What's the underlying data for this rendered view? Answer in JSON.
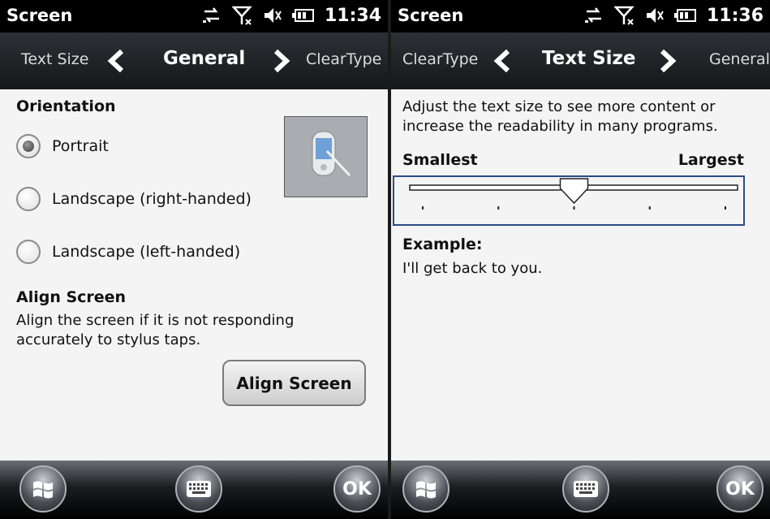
{
  "left": {
    "status": {
      "title": "Screen",
      "time": "11:34"
    },
    "nav": {
      "prev": "Text Size",
      "current": "General",
      "next": "ClearType"
    },
    "orientation": {
      "heading": "Orientation",
      "options": [
        {
          "label": "Portrait",
          "selected": true
        },
        {
          "label": "Landscape (right-handed)",
          "selected": false
        },
        {
          "label": "Landscape (left-handed)",
          "selected": false
        }
      ]
    },
    "align": {
      "heading": "Align Screen",
      "description_line1": "Align the screen if it is not responding",
      "description_line2": "accurately to stylus taps.",
      "button": "Align Screen"
    },
    "softkeys": {
      "right": "OK"
    }
  },
  "right": {
    "status": {
      "title": "Screen",
      "time": "11:36"
    },
    "nav": {
      "prev": "ClearType",
      "current": "Text Size",
      "next": "General"
    },
    "text_size": {
      "description_line1": "Adjust the text size to see more content or",
      "description_line2": "increase the readability in many programs.",
      "min_label": "Smallest",
      "max_label": "Largest",
      "steps": 5,
      "selected_step": 3,
      "example_heading": "Example:",
      "example_text": "I'll get back to you."
    },
    "softkeys": {
      "right": "OK"
    }
  },
  "colors": {
    "accent": "#2c4c86",
    "status_bg": "#000000"
  },
  "icons": [
    "data-sync-icon",
    "no-signal-icon",
    "speaker-muted-icon",
    "battery-icon",
    "windows-start-icon",
    "keyboard-icon"
  ]
}
